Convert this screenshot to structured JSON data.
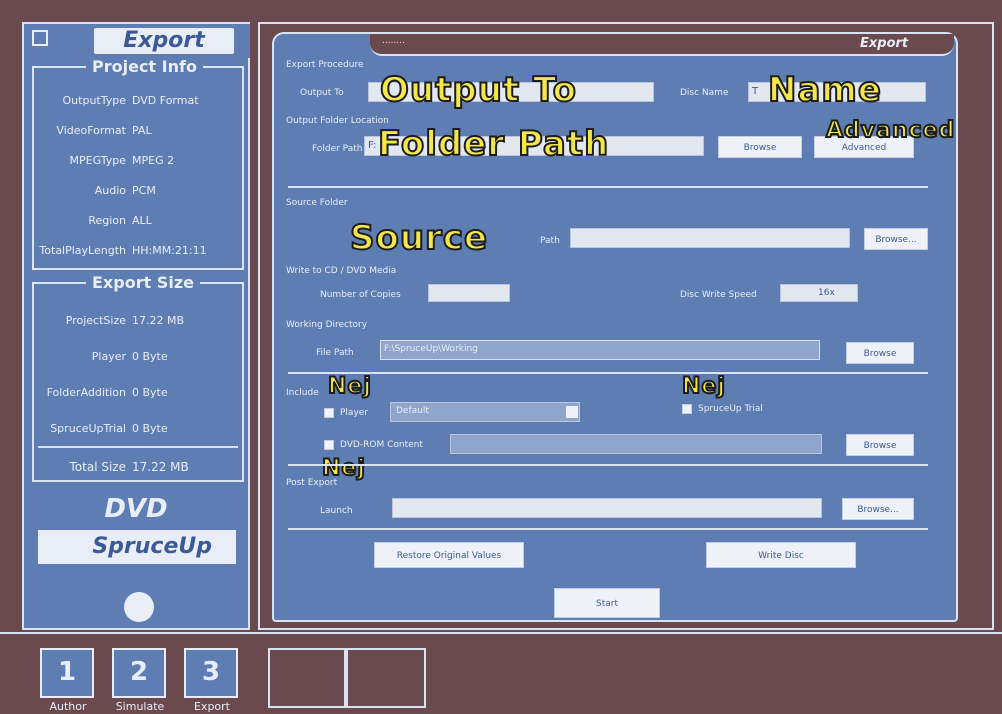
{
  "left_panel": {
    "title": "Export",
    "project_info": {
      "title": "Project Info",
      "rows": [
        {
          "label": "OutputType",
          "value": "DVD Format"
        },
        {
          "label": "VideoFormat",
          "value": "PAL"
        },
        {
          "label": "MPEGType",
          "value": "MPEG 2"
        },
        {
          "label": "Audio",
          "value": "PCM"
        },
        {
          "label": "Region",
          "value": "ALL"
        },
        {
          "label": "TotalPlayLength",
          "value": "HH:MM:21:11"
        }
      ]
    },
    "export_size": {
      "title": "Export Size",
      "rows": [
        {
          "label": "ProjectSize",
          "value": "17.22 MB"
        },
        {
          "label": "Player",
          "value": "0 Byte"
        },
        {
          "label": "FolderAddition",
          "value": "0 Byte"
        },
        {
          "label": "SpruceUpTrial",
          "value": "0 Byte"
        }
      ],
      "total": {
        "label": "Total Size",
        "value": "17.22 MB"
      }
    },
    "logos": {
      "dvd": "DVD",
      "spruceup": "SpruceUp"
    }
  },
  "bottom": {
    "steps": [
      {
        "num": "1",
        "label": "Author"
      },
      {
        "num": "2",
        "label": "Simulate"
      },
      {
        "num": "3",
        "label": "Export"
      }
    ]
  },
  "main": {
    "header_title": "Export",
    "header_dots": "........",
    "export_procedure": {
      "title": "Export Procedure",
      "output_to_label": "Output To",
      "output_to_highlight": "Output To",
      "disc_name_label": "Disc Name",
      "disc_name_highlight": "Name",
      "disc_name_value": "T"
    },
    "output_folder": {
      "title": "Output Folder Location",
      "folder_path_label": "Folder Path",
      "folder_path_highlight": "Folder Path",
      "folder_path_value": "F:",
      "browse": "Browse",
      "advanced": "Advanced",
      "advanced_highlight": "Advanced"
    },
    "source": {
      "title": "Source Folder",
      "source_highlight": "Source",
      "label_right": "Path",
      "browse": "Browse..."
    },
    "burn": {
      "title": "Write to CD / DVD Media",
      "copies_label": "Number of Copies",
      "speed_label": "Disc Write Speed",
      "speed_value": "16x"
    },
    "working": {
      "title": "Working Directory",
      "file_path_label": "File Path",
      "file_path_value": "F:\\SpruceUp\\Working",
      "browse": "Browse"
    },
    "include": {
      "title": "Include",
      "nej1": "Nej",
      "player_label": "Player",
      "player_select": "Default",
      "nej2": "Nej",
      "spruceup_trial": "SpruceUp Trial",
      "dvd_rom_label": "DVD-ROM Content",
      "browse": "Browse",
      "nej3": "Nej"
    },
    "post_export": {
      "title": "Post Export",
      "path_label": "Launch",
      "browse": "Browse..."
    },
    "buttons": {
      "restore": "Restore Original Values",
      "write": "Write Disc",
      "start": "Start"
    }
  }
}
